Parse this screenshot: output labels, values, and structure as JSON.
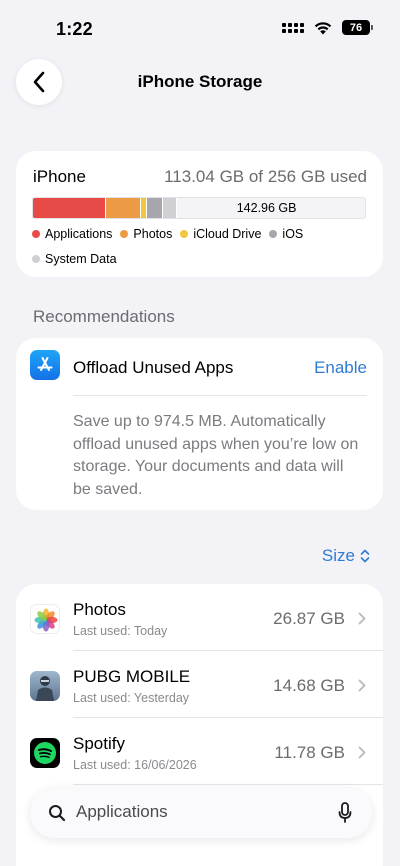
{
  "status_bar": {
    "time": "1:22",
    "battery": "76"
  },
  "nav": {
    "title": "iPhone Storage"
  },
  "storage": {
    "device": "iPhone",
    "used_text": "113.04 GB of 256 GB used",
    "free_label": "142.96 GB",
    "segments": [
      {
        "name": "Applications",
        "color": "#e84a48",
        "fraction": 0.22
      },
      {
        "name": "Photos",
        "color": "#ec9a44",
        "fraction": 0.105
      },
      {
        "name": "iCloud Drive",
        "color": "#f2c63d",
        "fraction": 0.018
      },
      {
        "name": "iOS",
        "color": "#a6a6ac",
        "fraction": 0.05
      },
      {
        "name": "System Data",
        "color": "#cfcfd4",
        "fraction": 0.04
      }
    ],
    "legend": [
      {
        "label": "Applications",
        "color": "#e84a48"
      },
      {
        "label": "Photos",
        "color": "#ec9a44"
      },
      {
        "label": "iCloud Drive",
        "color": "#f2c63d"
      },
      {
        "label": "iOS",
        "color": "#a6a6ac"
      },
      {
        "label": "System Data",
        "color": "#cfcfd4"
      }
    ]
  },
  "recommendations": {
    "header": "Recommendations",
    "item": {
      "icon": "app-store-icon",
      "title": "Offload Unused Apps",
      "action": "Enable",
      "description": "Save up to 974.5 MB. Automatically offload unused apps when you’re low on storage. Your documents and data will be saved."
    }
  },
  "sort": {
    "label": "Size"
  },
  "apps": [
    {
      "name": "Photos",
      "last_used": "Last used: Today",
      "size": "26.87 GB",
      "icon": "photos-icon"
    },
    {
      "name": "PUBG MOBILE",
      "last_used": "Last used: Yesterday",
      "size": "14.68 GB",
      "icon": "pubg-icon"
    },
    {
      "name": "Spotify",
      "last_used": "Last used: 16/06/2026",
      "size": "11.78 GB",
      "icon": "spotify-icon"
    }
  ],
  "search": {
    "placeholder": "Applications"
  },
  "colors": {
    "accent": "#2f7bd3",
    "background": "#f2f2f7",
    "secondary_text": "#6b6b70"
  }
}
